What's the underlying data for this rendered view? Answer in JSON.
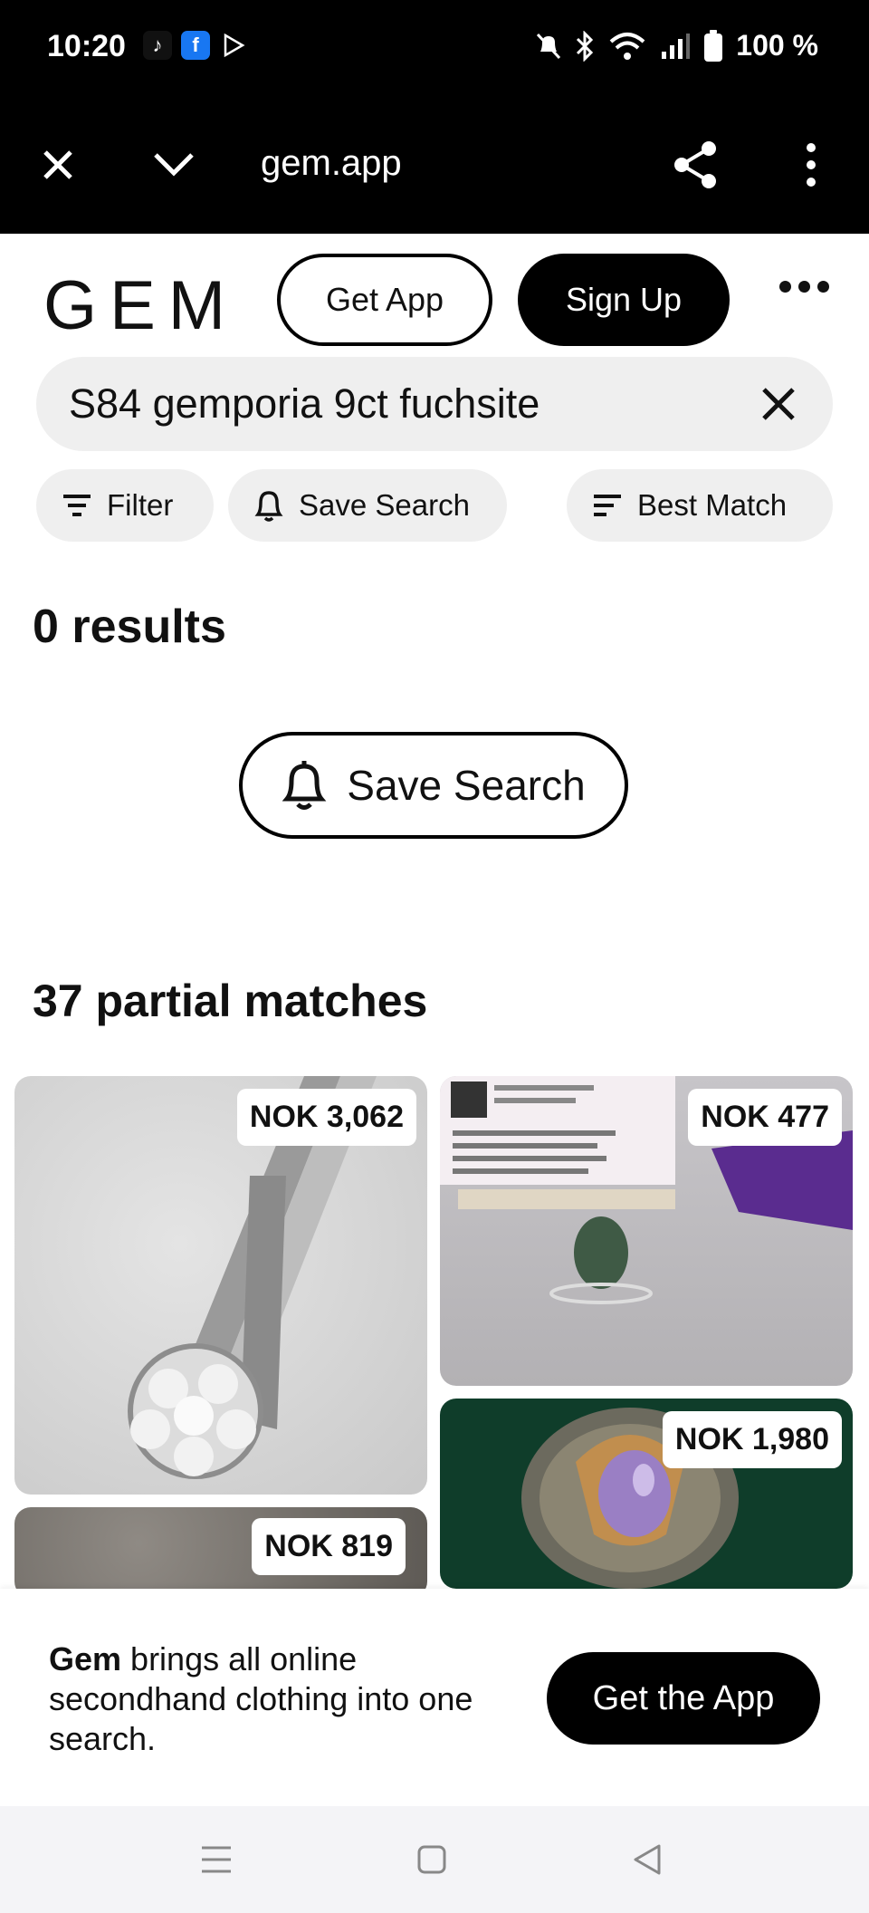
{
  "status": {
    "time": "10:20",
    "battery": "100 %",
    "app_icons": [
      "tiktok-icon",
      "facebook-icon",
      "play-store-icon"
    ],
    "right_icons": [
      "mute-icon",
      "bluetooth-icon",
      "wifi-icon",
      "signal-icon",
      "battery-icon"
    ]
  },
  "browser": {
    "url": "gem.app"
  },
  "header": {
    "logo": "GEM",
    "get_app": "Get App",
    "sign_up": "Sign Up"
  },
  "search": {
    "value": "S84 gemporia 9ct fuchsite"
  },
  "chips": {
    "filter": "Filter",
    "save_search": "Save Search",
    "sort": "Best Match"
  },
  "results": {
    "count_label": "0 results",
    "save_search_button": "Save Search",
    "partial_label": "37 partial matches"
  },
  "products": [
    {
      "price": "NOK 3,062"
    },
    {
      "price": "NOK 477"
    },
    {
      "price": "NOK 1,980"
    },
    {
      "price": "NOK 819"
    }
  ],
  "banner": {
    "brand": "Gem",
    "text": " brings all online secondhand clothing into one search.",
    "button": "Get the App"
  },
  "colors": {
    "primary": "#000000",
    "chip_bg": "#efefef",
    "card3_bg": "#0f3d2a"
  }
}
